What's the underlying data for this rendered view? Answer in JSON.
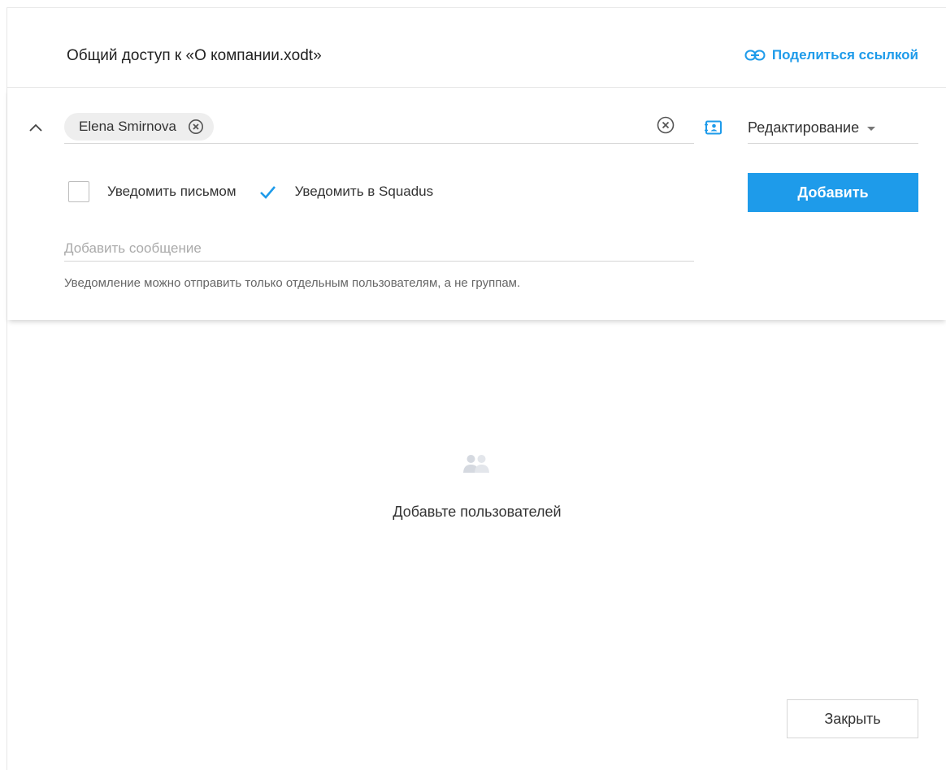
{
  "header": {
    "title": "Общий доступ к «О компании.xodt»",
    "share_link_label": "Поделиться ссылкой"
  },
  "recipients": {
    "chips": [
      {
        "label": "Elena Smirnova"
      }
    ],
    "role_value": "Редактирование"
  },
  "notify": {
    "by_email_label": "Уведомить письмом",
    "by_email_checked": false,
    "in_app_label": "Уведомить в Squadus",
    "in_app_checked": true
  },
  "add_button_label": "Добавить",
  "message": {
    "placeholder": "Добавить сообщение",
    "value": ""
  },
  "hint": "Уведомление можно отправить только отдельным пользователям, а не группам.",
  "empty_state": {
    "icon": "users-icon",
    "text": "Добавьте пользователей"
  },
  "close_button_label": "Закрыть",
  "colors": {
    "accent": "#1e9bea",
    "icon_gray": "#7a7a7a",
    "empty_icon": "#d5d9e0"
  }
}
